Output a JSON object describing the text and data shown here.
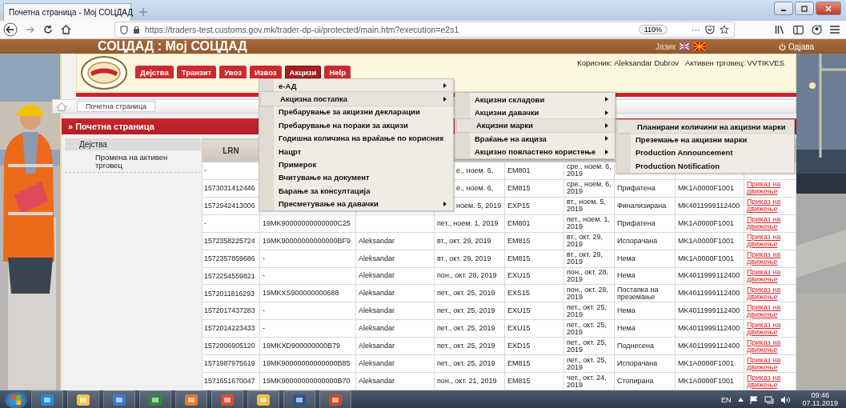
{
  "browser": {
    "tab_title": "Почетна страница - Moj СОЦДАД",
    "url": "https://traders-test.customs.gov.mk/trader-dp-ui/protected/main.htm?execution=e2s1",
    "zoom": "110%",
    "more": "···"
  },
  "site": {
    "title": "СОЦДАД : Moj СОЦДАД",
    "language_label": "Јазик",
    "logout": "Одјава",
    "user": "Корисник: Aleksandar Dubrov",
    "active_trader": "Активен трговец: VVTIKVES"
  },
  "nav": [
    {
      "label": "Дејства",
      "selected": false
    },
    {
      "label": "Транзит",
      "selected": false
    },
    {
      "label": "Увоз",
      "selected": false
    },
    {
      "label": "Извоз",
      "selected": false
    },
    {
      "label": "Акцизи",
      "selected": true
    },
    {
      "label": "Help",
      "selected": false
    }
  ],
  "breadcrumb": "Почетна страница",
  "page_title": "» Почетна страница",
  "sidebar": {
    "heading": "Дејства",
    "items": [
      "Промена на активен трговец"
    ]
  },
  "menus": [
    {
      "items": [
        {
          "label": "е-АД",
          "submenu": true,
          "selected": false
        },
        {
          "label": "Акцизна постапка",
          "submenu": true,
          "selected": true
        },
        {
          "label": "Пребарување за акцизни декларации",
          "submenu": false,
          "selected": false
        },
        {
          "label": "Пребарување на пораки за акцизи",
          "submenu": false,
          "selected": false
        },
        {
          "label": "Годишна количина на враќање по корисник",
          "submenu": false,
          "selected": false
        },
        {
          "label": "Нацрт",
          "submenu": false,
          "selected": false
        },
        {
          "label": "Примерок",
          "submenu": false,
          "selected": false
        },
        {
          "label": "Вчитување на документ",
          "submenu": false,
          "selected": false
        },
        {
          "label": "Барање за консултација",
          "submenu": false,
          "selected": false
        },
        {
          "label": "Пресметување на давачки",
          "submenu": true,
          "selected": false
        }
      ]
    },
    {
      "items": [
        {
          "label": "Акцизни складови",
          "submenu": true,
          "selected": false
        },
        {
          "label": "Акцизни давачки",
          "submenu": true,
          "selected": false
        },
        {
          "label": "Акцизни марки",
          "submenu": true,
          "selected": true
        },
        {
          "label": "Враќање на акциза",
          "submenu": true,
          "selected": false
        },
        {
          "label": "Акцизно повластено користење",
          "submenu": true,
          "selected": false
        }
      ]
    },
    {
      "items": [
        {
          "label": "Планирани количини на акцизни марки",
          "submenu": false,
          "selected": true
        },
        {
          "label": "Преземање на акцизни марки",
          "submenu": false,
          "selected": false
        },
        {
          "label": "Production Announcement",
          "submenu": false,
          "selected": false
        },
        {
          "label": "Production Notification",
          "submenu": false,
          "selected": false
        }
      ]
    }
  ],
  "table": {
    "columns": [
      "LRN"
    ],
    "rows": [
      {
        "lrn": "-",
        "column_4": "е., ноем. 6,",
        "column_5": "EM801",
        "column_6": "сре., ноем. 6, 2019"
      },
      {
        "lrn": "1573031412446",
        "column_4": "е., ноем. 6,",
        "column_5": "EM815",
        "column_6": "сре., ноем. 6, 2019",
        "column_7": "Прифатена",
        "column_8": "MK1A0000F1001",
        "column_9": "Приказ на движење"
      },
      {
        "lrn": "1572942413006",
        "column_4": "ноем. 5, 2019",
        "column_5": "EXP15",
        "column_6": "вт., ноем. 5, 2019",
        "column_7": "Финализирана",
        "column_8": "MK4011999112400",
        "column_9": "Приказ на движење"
      },
      {
        "lrn": "-",
        "column_2": "19MK90000000000000C25",
        "column_4": "пет., ноем. 1, 2019",
        "column_5": "EM801",
        "column_6": "пет., ноем. 1, 2019",
        "column_7": "Прифатена",
        "column_8": "MK1A0000F1001",
        "column_9": "Приказ на движење"
      },
      {
        "lrn": "1572358225724",
        "column_2": "19MK90000000000000BF9",
        "column_3": "Aleksandar",
        "column_4": "вт., окт. 29, 2019",
        "column_5": "EM815",
        "column_6": "вт., окт. 29, 2019",
        "column_7": "Испорачана",
        "column_8": "MK1A0000F1001",
        "column_9": "Приказ на движење"
      },
      {
        "lrn": "1572357859686",
        "column_2": "-",
        "column_3": "Aleksandar",
        "column_4": "вт., окт. 29, 2019",
        "column_5": "EM815",
        "column_6": "вт., окт. 29, 2019",
        "column_7": "Нема",
        "column_8": "MK1A0000F1001",
        "column_9": "Приказ на движење"
      },
      {
        "lrn": "1572254559821",
        "column_2": "-",
        "column_3": "Aleksandar",
        "column_4": "пон., окт. 28, 2019",
        "column_5": "EXU15",
        "column_6": "пон., окт. 28, 2019",
        "column_7": "Нема",
        "column_8": "MK4011999112400",
        "column_9": "Приказ на движење"
      },
      {
        "lrn": "1572011816293",
        "column_2": "19MKXS900000000688",
        "column_3": "Aleksandar",
        "column_4": "пет., окт. 25, 2019",
        "column_5": "EXS15",
        "column_6": "пон., окт. 28, 2019",
        "column_7": "Постапка на преземање",
        "column_8": "MK4011999112400",
        "column_9": "Приказ на движење"
      },
      {
        "lrn": "1572017437283",
        "column_2": "-",
        "column_3": "Aleksandar",
        "column_4": "пет., окт. 25, 2019",
        "column_5": "EXU15",
        "column_6": "пет., окт. 25, 2019",
        "column_7": "Нема",
        "column_8": "MK4011999112400",
        "column_9": "Приказ на движење"
      },
      {
        "lrn": "1572014223433",
        "column_2": "-",
        "column_3": "Aleksandar",
        "column_4": "пет., окт. 25, 2019",
        "column_5": "EXU15",
        "column_6": "пет., окт. 25, 2019",
        "column_7": "Нема",
        "column_8": "MK4011999112400",
        "column_9": "Приказ на движење"
      },
      {
        "lrn": "1572006905120",
        "column_2": "19MKXD900000000B79",
        "column_3": "Aleksandar",
        "column_4": "пет., окт. 25, 2019",
        "column_5": "EXD15",
        "column_6": "пет., окт. 25, 2019",
        "column_7": "Поднесена",
        "column_8": "MK4011999112400",
        "column_9": "Приказ на движење"
      },
      {
        "lrn": "1571987975619",
        "column_2": "19MK90000000000000B85",
        "column_3": "Aleksandar",
        "column_4": "пет., окт. 25, 2019",
        "column_5": "EM815",
        "column_6": "пет., окт. 25, 2019",
        "column_7": "Испорачана",
        "column_8": "MK1A0000F1001",
        "column_9": "Приказ на движење"
      },
      {
        "lrn": "1571651670047",
        "column_2": "19MK90000000000000B70",
        "column_3": "Aleksandar",
        "column_4": "пон., окт. 21, 2019",
        "column_5": "EM815",
        "column_6": "чет., окт. 24, 2019",
        "column_7": "Стопирана",
        "column_8": "MK1A0000F1001",
        "column_9": "Приказ на движење"
      }
    ]
  },
  "taskbar": {
    "language": "EN",
    "time": "09:46",
    "date": "07.11.2019"
  }
}
